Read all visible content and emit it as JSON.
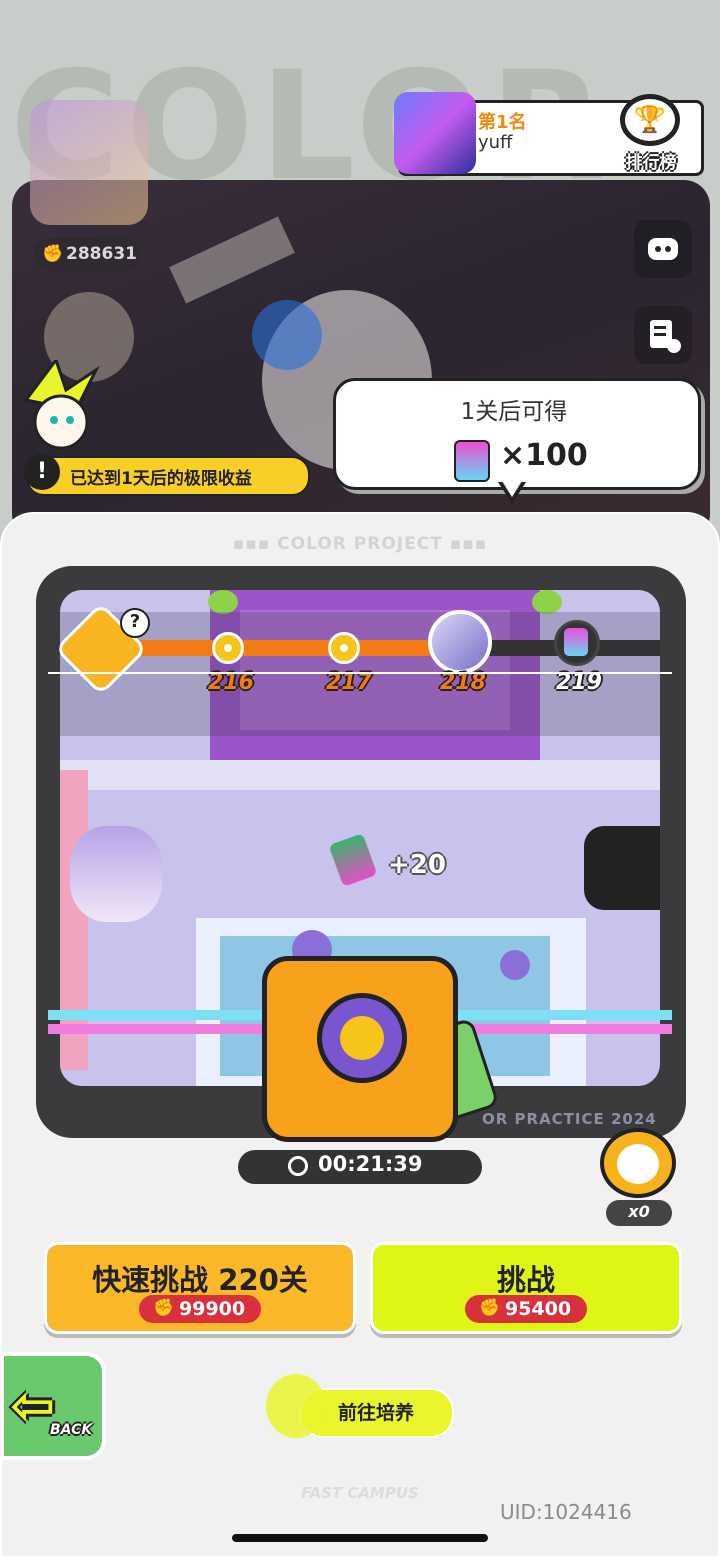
{
  "background": {
    "wordmark": "COLOR"
  },
  "leaderboard": {
    "position": "第1名",
    "player_name": "yuff",
    "button_label": "排行榜"
  },
  "player": {
    "power": "288631"
  },
  "notice": {
    "text": "已达到1天后的极限收益"
  },
  "reward_bubble": {
    "title": "1关后可得",
    "count": "×100",
    "item_icon": "paint-can-icon"
  },
  "panel": {
    "title": "COLOR PROJECT",
    "stage_watermark": "OR PRACTICE 2024",
    "levels": [
      "216",
      "217",
      "218",
      "219"
    ],
    "pickup_text": "+20",
    "timer": "00:21:39",
    "clock_count": "x0"
  },
  "buttons": {
    "quick_challenge": {
      "label": "快速挑战 220关",
      "cost": "99900"
    },
    "challenge": {
      "label": "挑战",
      "cost": "95400"
    },
    "back": "BACK",
    "train": "前往培养"
  },
  "footer": {
    "brand": "FAST CAMPUS",
    "uid": "UID:1024416"
  },
  "colors": {
    "accent_orange": "#f37b16",
    "accent_yellow": "#fbb828",
    "accent_lime": "#dff516",
    "cost_red": "#d9313b"
  }
}
